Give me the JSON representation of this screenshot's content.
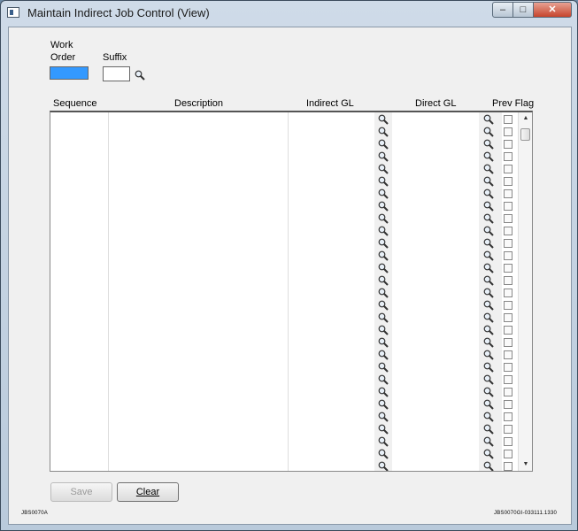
{
  "window": {
    "title": "Maintain Indirect Job Control (View)",
    "close_glyph": "✕",
    "max_glyph": "□",
    "min_glyph": "‒"
  },
  "form": {
    "work_order_label_line1": "Work",
    "work_order_label_line2": "Order",
    "work_order_value": "",
    "suffix_label": "Suffix",
    "suffix_value": ""
  },
  "grid": {
    "columns": [
      "Sequence",
      "Description",
      "Indirect GL",
      "Direct GL",
      "Prev Flag"
    ],
    "row_count": 29,
    "rows": []
  },
  "buttons": {
    "save": "Save",
    "clear": "Clear"
  },
  "footer": {
    "left_code": "JBS0070A",
    "right_code": "JBS0070GI-033111.1330"
  },
  "colors": {
    "selected_field": "#3399ff"
  }
}
